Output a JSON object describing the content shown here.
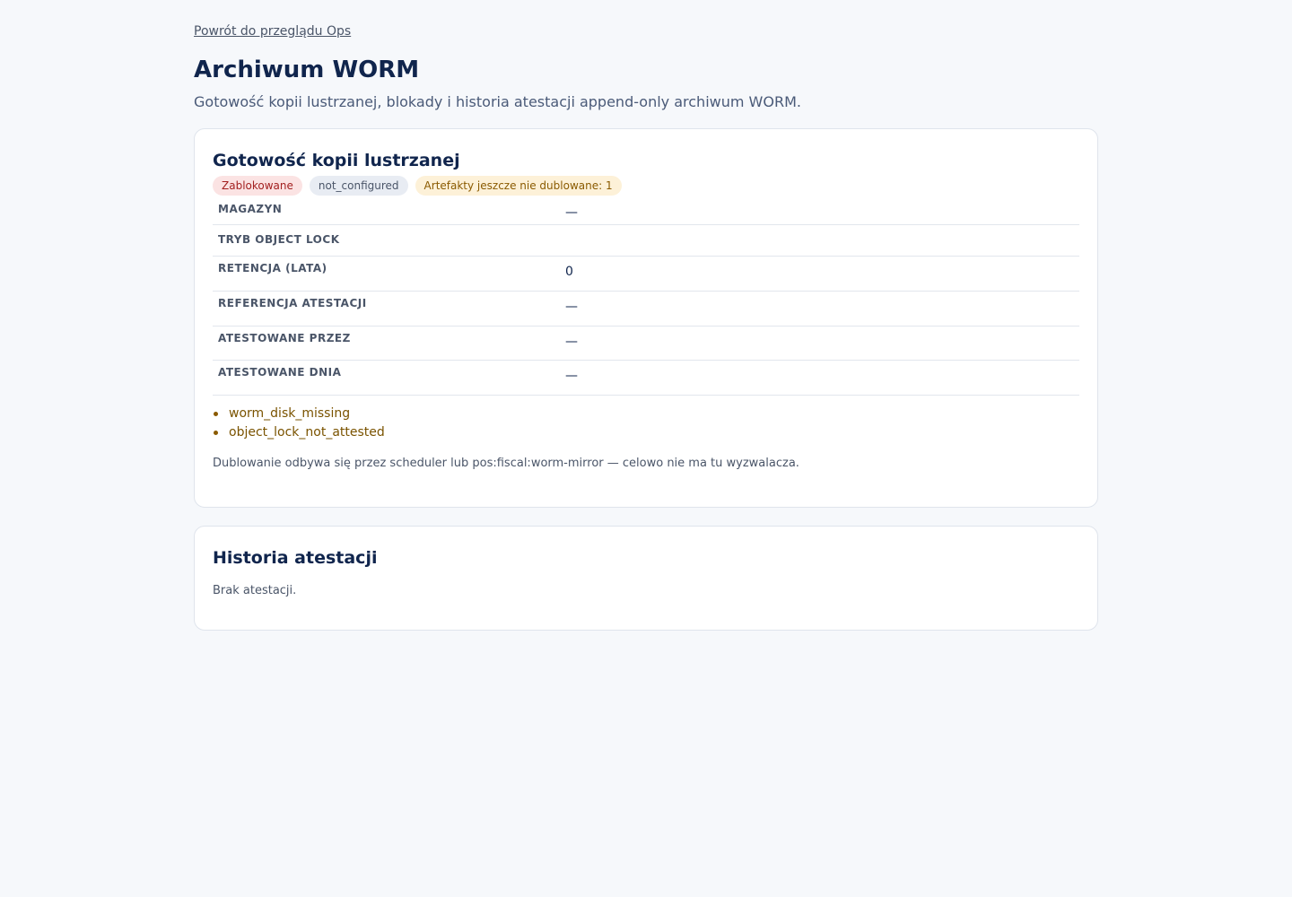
{
  "back_link": "Powrót do przeglądu Ops",
  "title": "Archiwum WORM",
  "subtitle": "Gotowość kopii lustrzanej, blokady i historia atestacji append-only archiwum WORM.",
  "readiness": {
    "title": "Gotowość kopii lustrzanej",
    "badges": [
      {
        "label": "Zablokowane",
        "kind": "blocked"
      },
      {
        "label": "not_configured",
        "kind": "neutral"
      },
      {
        "label": "Artefakty jeszcze nie dublowane: 1",
        "kind": "warn"
      }
    ],
    "rows": [
      {
        "key": "Magazyn",
        "value": "—"
      },
      {
        "key": "Tryb Object Lock",
        "value": ""
      },
      {
        "key": "Retencja (lata)",
        "value": "0"
      },
      {
        "key": "Referencja atestacji",
        "value": "—"
      },
      {
        "key": "Atestowane przez",
        "value": "—"
      },
      {
        "key": "Atestowane dnia",
        "value": "—"
      }
    ],
    "issues": [
      "worm_disk_missing",
      "object_lock_not_attested"
    ],
    "note": "Dublowanie odbywa się przez scheduler lub pos:fiscal:worm-mirror — celowo nie ma tu wyzwalacza."
  },
  "history": {
    "title": "Historia atestacji",
    "empty": "Brak atestacji."
  },
  "colors": {
    "background": "#f6f8fb",
    "title": "#10254d",
    "badge_blocked_bg": "#fbe3e3",
    "badge_blocked_fg": "#a32020",
    "badge_neutral_bg": "#e8ecf3",
    "badge_warn_bg": "#fdf1d8",
    "badge_warn_fg": "#8a5a00",
    "issue_text": "#7a5300"
  }
}
